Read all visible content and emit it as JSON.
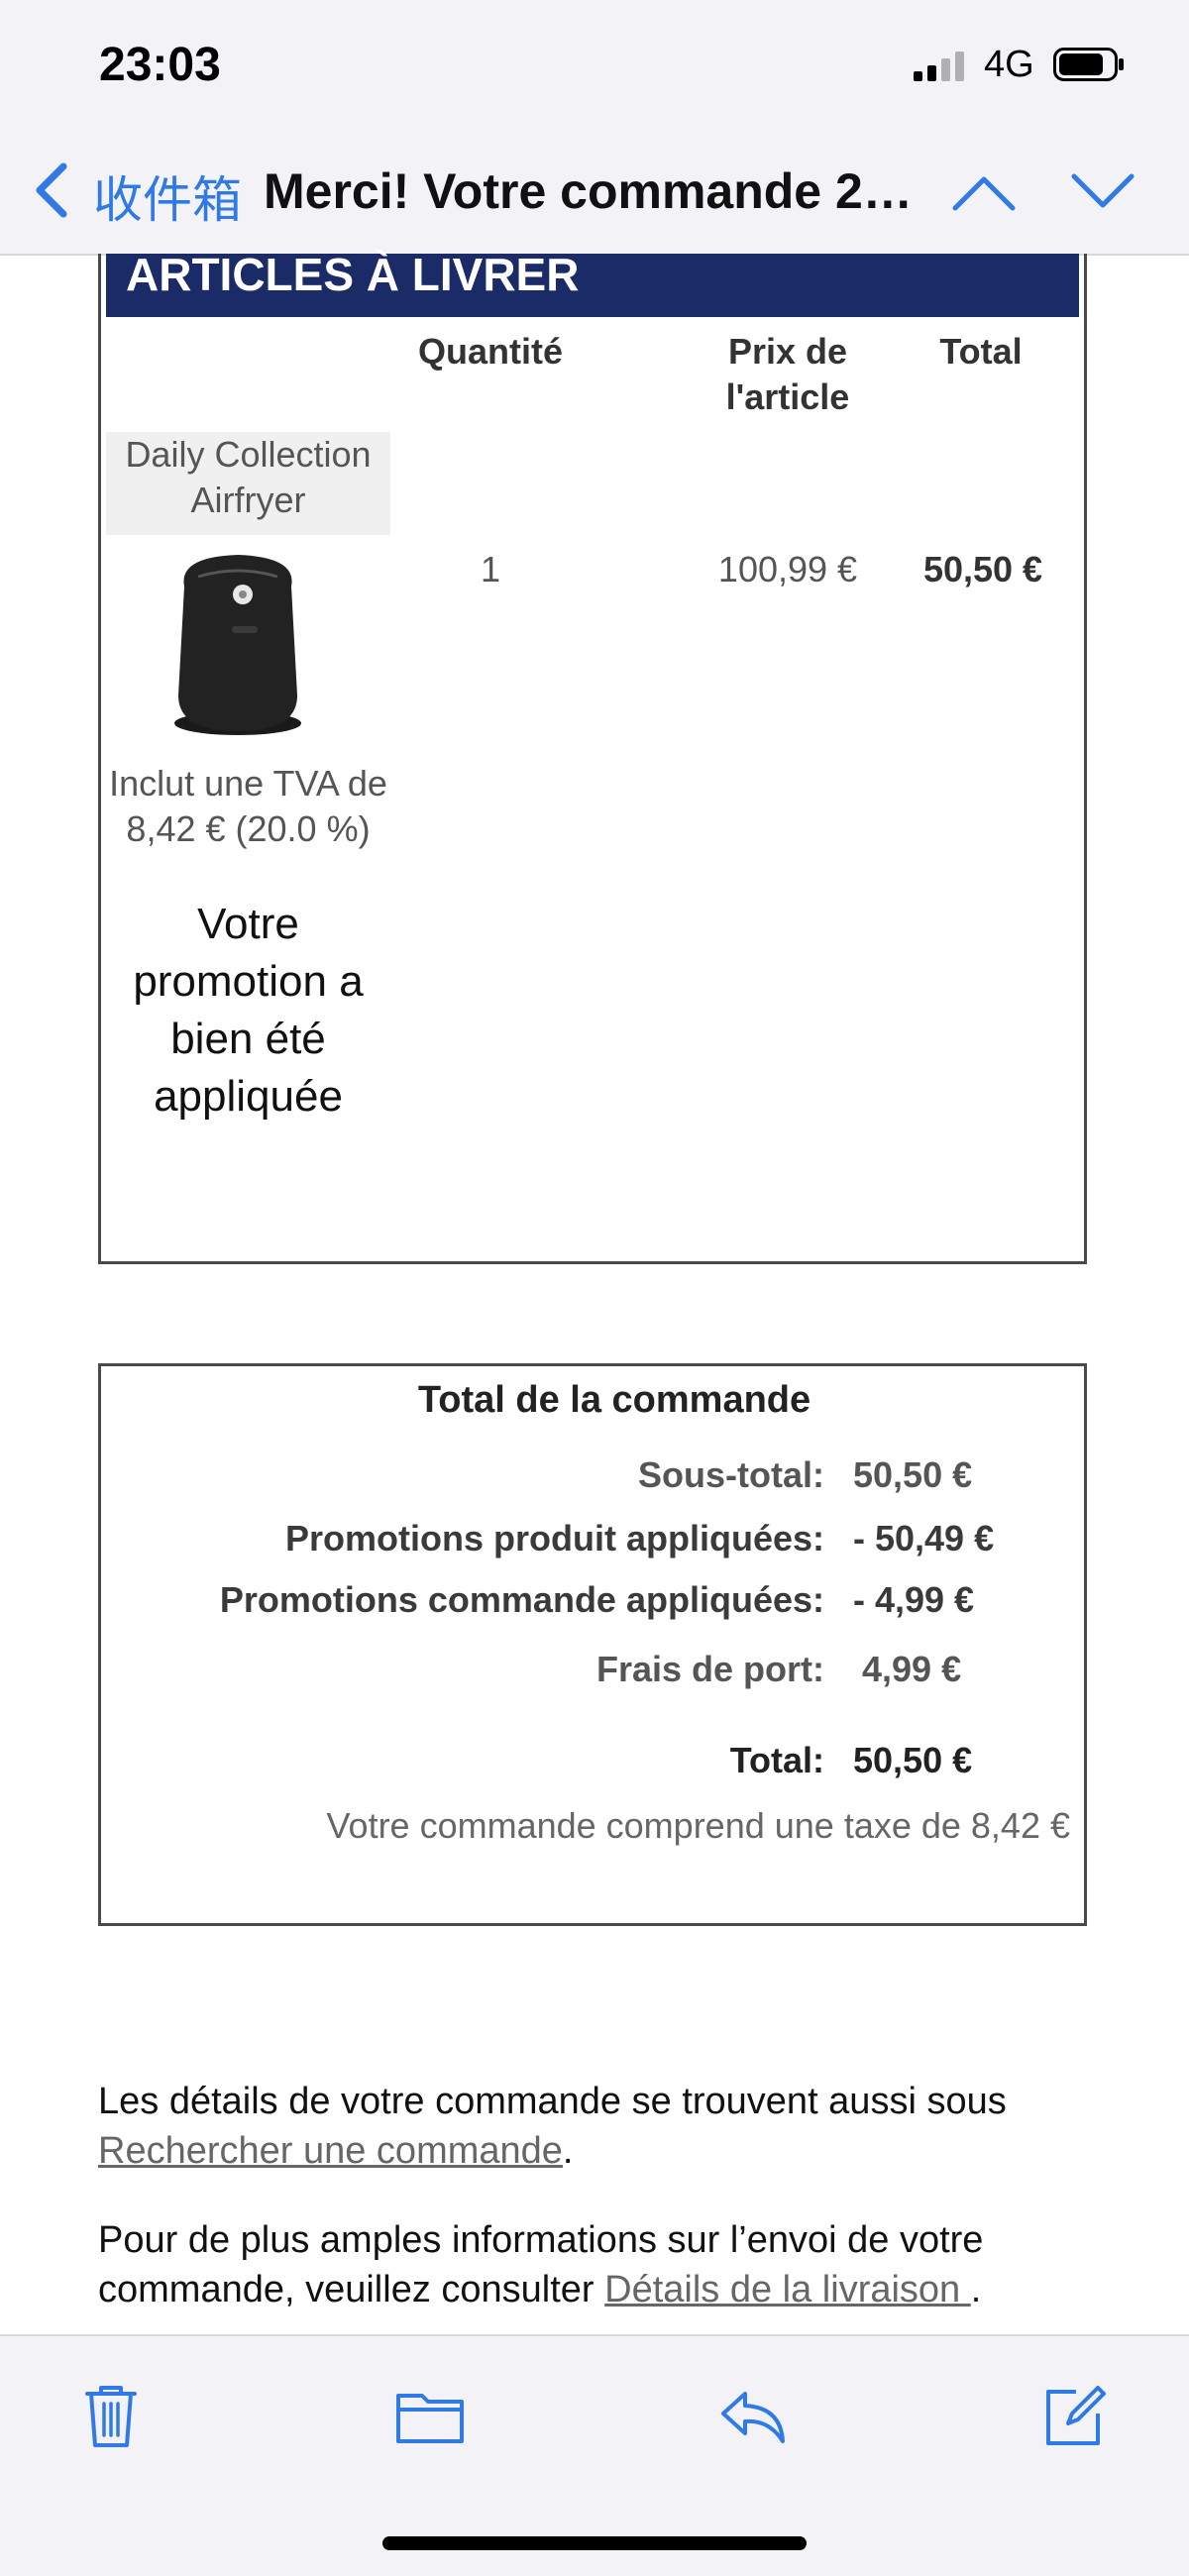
{
  "status_bar": {
    "time": "23:03",
    "network": "4G"
  },
  "nav": {
    "back_label": "收件箱",
    "title": "Merci! Votre commande 24..."
  },
  "articles": {
    "header": "ARTICLES À LIVRER",
    "columns": {
      "quantity": "Quantité",
      "price": "Prix de l'article",
      "total": "Total"
    },
    "item": {
      "name": "Daily Collection Airfryer",
      "image_icon": "airfryer-image",
      "tva": "Inclut une TVA de 8,42 € (20.0 %)",
      "promotion": "Votre promotion a bien été appliquée",
      "quantity": "1",
      "price": "100,99 €",
      "total": "50,50 €"
    }
  },
  "order_totals": {
    "title": "Total de la commande",
    "rows": [
      {
        "label": "Sous-total:",
        "value": "50,50 €"
      },
      {
        "label": "Promotions produit appliquées:",
        "value": "- 50,49 €"
      },
      {
        "label": "Promotions commande appliquées:",
        "value": "- 4,99 €"
      },
      {
        "label": "Frais de port:",
        "value": "4,99 €"
      },
      {
        "label": "Total:",
        "value": "50,50 €"
      }
    ],
    "tax_note": "Votre commande comprend une taxe de 8,42 €"
  },
  "info": {
    "p1_text": "Les détails de votre commande se trouvent aussi sous",
    "p1_link": "Rechercher une commande",
    "p1_end": ".",
    "p2_text": "Pour de plus amples informations sur l’envoi de votre commande, veuillez consulter",
    "p2_link": "Détails de la livraison ",
    "p2_end": "."
  },
  "toolbar": {
    "icons": [
      "trash-icon",
      "folder-icon",
      "reply-icon",
      "compose-icon"
    ]
  },
  "colors": {
    "accent": "#2f7ae5",
    "header_bg": "#1a2b68"
  }
}
